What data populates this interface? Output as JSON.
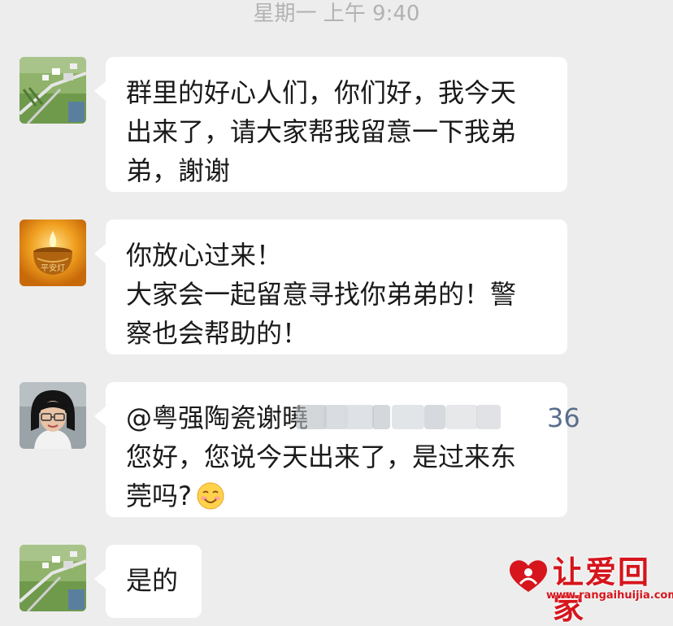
{
  "timestamp": "星期一 上午 9:40",
  "messages": [
    {
      "sender_avatar": "aerial-village-photo",
      "lines": [
        "群里的好心人们，你们好，我今天",
        "出来了，请大家帮我留意一下我弟",
        "弟，謝谢"
      ]
    },
    {
      "sender_avatar": "candle-lamp-pingan",
      "lines": [
        "你放心过来！",
        "大家会一起留意寻找你弟弟的！警",
        "察也会帮助的！"
      ]
    },
    {
      "sender_avatar": "woman-with-glasses-photo",
      "mention": "@粤强陶瓷谢曉",
      "mention_tail": "36",
      "lines": [
        "您好，您说今天出来了，是过来东",
        "莞吗?"
      ],
      "emoji": "smile-emoji"
    },
    {
      "sender_avatar": "aerial-village-photo",
      "lines": [
        "是的"
      ]
    }
  ],
  "avatar_badge_text": "平安灯",
  "watermark": {
    "title": "让爱回家",
    "url": "www.rangaihuijia.com",
    "color": "#d6151c"
  },
  "colors": {
    "background": "#ededed",
    "bubble": "#ffffff",
    "timestamp": "#b2b2b2",
    "text": "#1a1a1a"
  }
}
